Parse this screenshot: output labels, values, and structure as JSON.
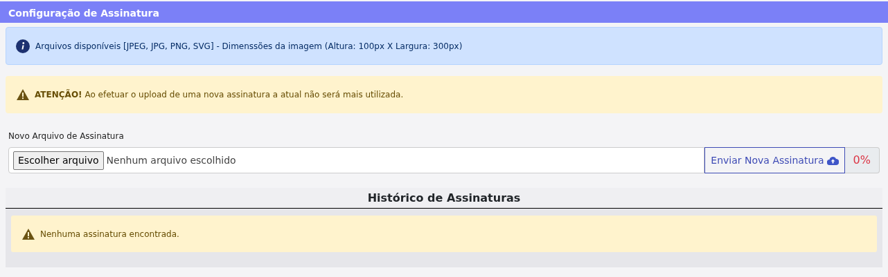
{
  "header": {
    "title": "Configuração de Assinatura"
  },
  "info_alert": {
    "text": "Arquivos disponíveis [JPEG, JPG, PNG, SVG] - Dimenssões da imagem (Altura: 100px X Largura: 300px)"
  },
  "warning_alert": {
    "text": "**ATENÇÃO!** Ao efetuar o upload de uma nova assinatura a atual não será mais utilizada."
  },
  "upload": {
    "label": "Novo Arquivo de Assinatura",
    "choose_button": "Escolher arquivo",
    "file_status": "Nenhum arquivo escolhido",
    "send_button": "Enviar Nova Assinatura",
    "progress": "0%"
  },
  "history": {
    "title": "Histórico de Assinaturas",
    "empty_message": "Nenhuma assinatura encontrada."
  }
}
